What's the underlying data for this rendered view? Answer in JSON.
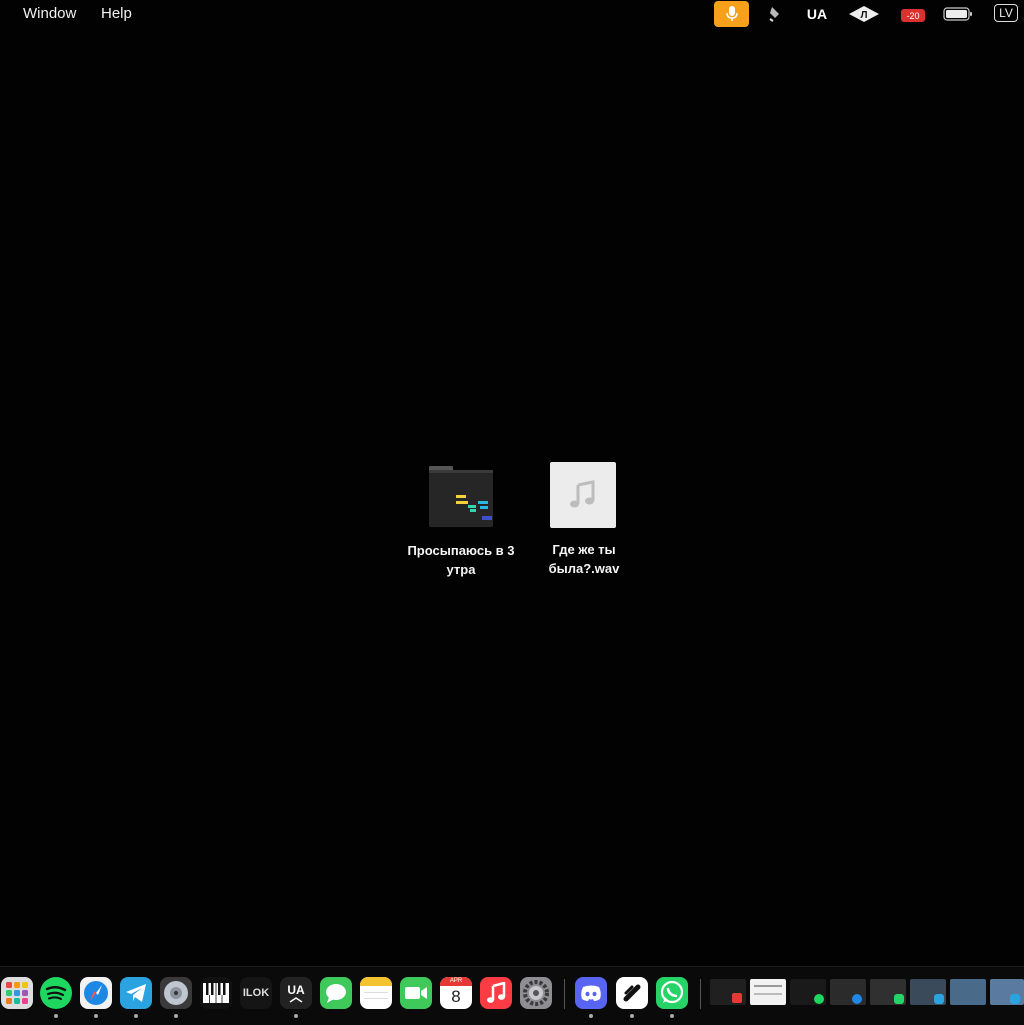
{
  "menubar": {
    "menus": [
      "Window",
      "Help"
    ],
    "status": {
      "mic_icon": "microphone-icon",
      "pen_icon": "pen-icon",
      "ua_label": "UA",
      "volume_badge": "-20",
      "lv_label": "LV"
    }
  },
  "desktop": {
    "items": [
      {
        "label": "Просыпаюсь в 3 утра",
        "icon": "folder-icon"
      },
      {
        "label": "Где же ты была?.wav",
        "icon": "audio-file-icon"
      }
    ]
  },
  "dock": {
    "apps": [
      {
        "name": "Launchpad",
        "icon": "launchpad-icon",
        "running": false
      },
      {
        "name": "Spotify",
        "icon": "spotify-icon",
        "running": true
      },
      {
        "name": "Safari",
        "icon": "safari-icon",
        "running": true
      },
      {
        "name": "Telegram",
        "icon": "telegram-icon",
        "running": true
      },
      {
        "name": "Disk Utility",
        "icon": "disk-icon",
        "running": true
      },
      {
        "name": "Piano",
        "icon": "piano-icon",
        "running": false
      },
      {
        "name": "iLok",
        "icon": "ilok-icon",
        "running": false,
        "label": "ILOK"
      },
      {
        "name": "UA Connect",
        "icon": "ua-icon",
        "running": true,
        "label": "UA"
      },
      {
        "name": "Messages",
        "icon": "messages-icon",
        "running": false
      },
      {
        "name": "Notes",
        "icon": "notes-icon",
        "running": false
      },
      {
        "name": "FaceTime",
        "icon": "facetime-icon",
        "running": false
      },
      {
        "name": "Calendar",
        "icon": "calendar-icon",
        "running": false,
        "month": "APR",
        "day": "8"
      },
      {
        "name": "Music",
        "icon": "music-icon",
        "running": false
      },
      {
        "name": "System Settings",
        "icon": "gear-icon",
        "running": false
      },
      {
        "name": "Discord",
        "icon": "discord-icon",
        "running": true
      },
      {
        "name": "Shortcut",
        "icon": "shortcut-icon",
        "running": true
      },
      {
        "name": "WhatsApp",
        "icon": "whatsapp-icon",
        "running": true
      }
    ],
    "recents_count": 8
  },
  "colors": {
    "mic_bg": "#f7a01c",
    "spotify": "#1ed760",
    "telegram": "#2aa3e0",
    "discord": "#5865f2",
    "whatsapp": "#25d366"
  }
}
